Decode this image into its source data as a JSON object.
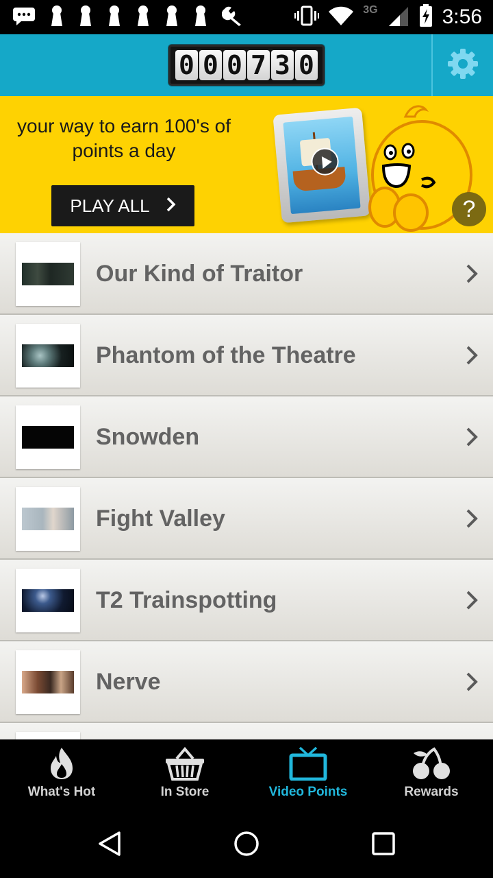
{
  "status_bar": {
    "time": "3:56",
    "network": "3G",
    "icons": [
      "message-icon",
      "keyhole-icon",
      "keyhole-icon",
      "keyhole-icon",
      "keyhole-icon",
      "keyhole-icon",
      "keyhole-icon",
      "wrench-icon",
      "vibrate-icon",
      "wifi-icon",
      "signal-icon",
      "battery-charging-icon"
    ]
  },
  "header": {
    "points_digits": [
      "0",
      "0",
      "0",
      "7",
      "3",
      "0"
    ],
    "settings_icon": "gear-icon",
    "accent_color": "#15a8c8"
  },
  "banner": {
    "text": "your way to earn 100's of points a day",
    "play_all_label": "PLAY ALL",
    "help_label": "?",
    "background_color": "#fed202"
  },
  "videos": [
    {
      "title": "Our Kind of Traitor"
    },
    {
      "title": "Phantom of the Theatre"
    },
    {
      "title": "Snowden"
    },
    {
      "title": "Fight Valley"
    },
    {
      "title": "T2 Trainspotting"
    },
    {
      "title": "Nerve"
    }
  ],
  "tabs": [
    {
      "label": "What's Hot",
      "icon": "flame-icon",
      "active": false
    },
    {
      "label": "In Store",
      "icon": "basket-icon",
      "active": false
    },
    {
      "label": "Video Points",
      "icon": "tv-icon",
      "active": true
    },
    {
      "label": "Rewards",
      "icon": "cherries-icon",
      "active": false
    }
  ],
  "nav_bar": {
    "back_icon": "back-icon",
    "home_icon": "home-icon",
    "recents_icon": "recents-icon"
  }
}
